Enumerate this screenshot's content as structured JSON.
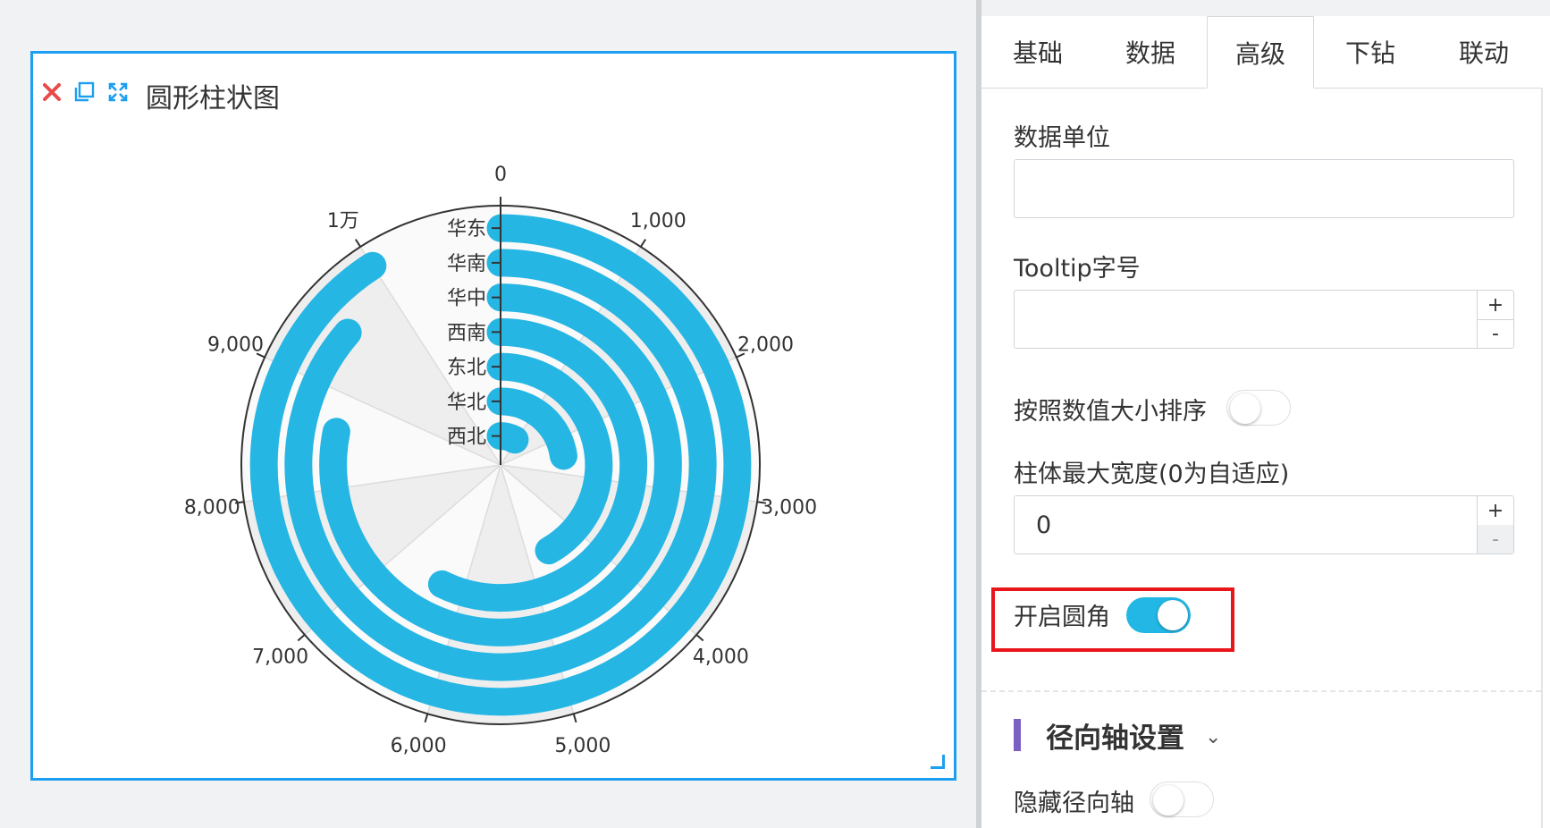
{
  "widget": {
    "title": "圆形柱状图",
    "icons": [
      "close-icon",
      "copy-icon",
      "expand-icon"
    ],
    "accent_color": "#1c9ff0",
    "close_color": "#e84a4a"
  },
  "chart_data": {
    "type": "polar-bar",
    "categories": [
      "华东",
      "华南",
      "华中",
      "西南",
      "东北",
      "华北",
      "西北"
    ],
    "values": [
      10000,
      9500,
      8600,
      6300,
      4600,
      2500,
      900
    ],
    "angle_axis": {
      "min": 0,
      "max": 11000,
      "ticks": [
        0,
        1000,
        2000,
        3000,
        4000,
        5000,
        6000,
        7000,
        8000,
        9000,
        10000
      ],
      "tick_labels": [
        "0",
        "1,000",
        "2,000",
        "3,000",
        "4,000",
        "5,000",
        "6,000",
        "7,000",
        "8,000",
        "9,000",
        "1万"
      ]
    },
    "bar_color": "#26b6e4",
    "round_cap": true
  },
  "panel": {
    "tabs": [
      "基础",
      "数据",
      "高级",
      "下钻",
      "联动"
    ],
    "active_tab": "高级",
    "data_unit": {
      "label": "数据单位",
      "value": ""
    },
    "tooltip_font": {
      "label": "Tooltip字号",
      "value": "",
      "plus": "+",
      "minus": "-"
    },
    "sort_by_value": {
      "label": "按照数值大小排序",
      "on": false
    },
    "bar_max_width": {
      "label": "柱体最大宽度(0为自适应)",
      "value": "0",
      "plus": "+",
      "minus": "-"
    },
    "round_corner": {
      "label": "开启圆角",
      "on": true
    },
    "radial_section": {
      "title": "径向轴设置",
      "chevron": "⌄"
    },
    "hide_radial_axis": {
      "label": "隐藏径向轴",
      "on": false
    },
    "highlight_color": "#e8161b",
    "toggle_on_color": "#23b7e5"
  }
}
